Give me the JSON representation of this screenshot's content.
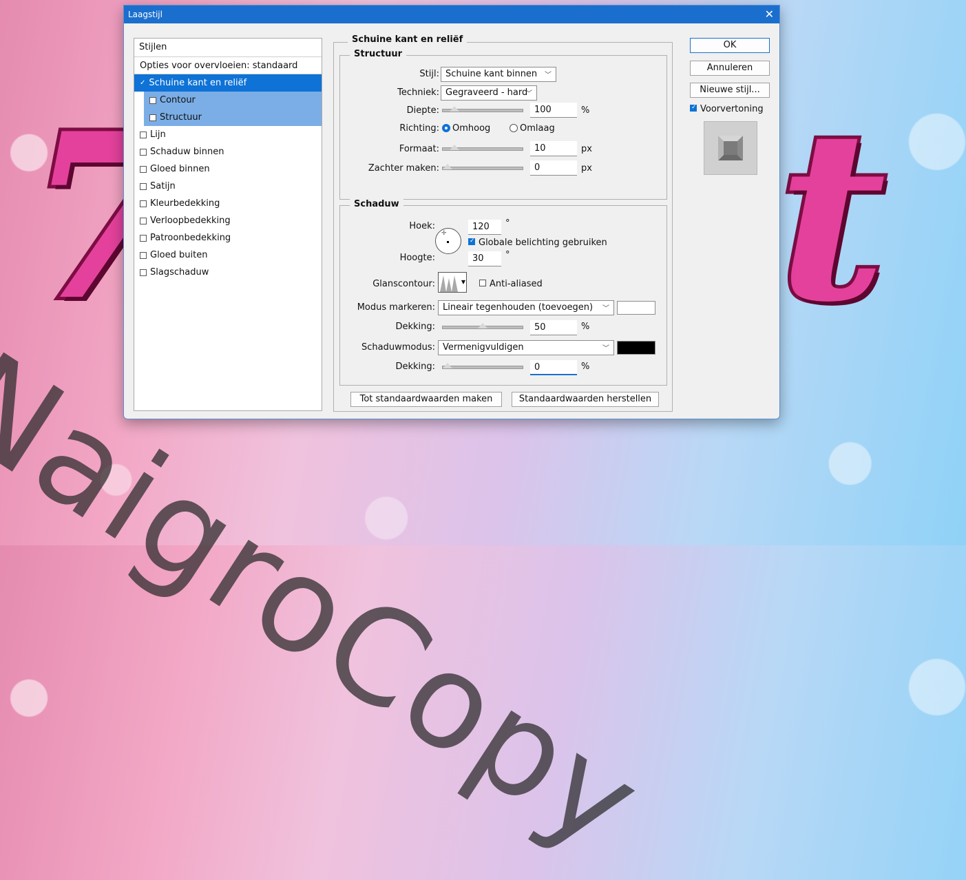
{
  "dialog": {
    "title": "Laagstijl",
    "close_glyph": "✕"
  },
  "styles_panel": {
    "header": "Stijlen",
    "blend_options": "Opties voor overvloeien: standaard",
    "items": [
      {
        "label": "Schuine kant en reliëf",
        "checked": true,
        "selected": true
      },
      {
        "label": "Contour",
        "checked": false,
        "sub": true
      },
      {
        "label": "Structuur",
        "checked": false,
        "sub": true
      },
      {
        "label": "Lijn",
        "checked": false
      },
      {
        "label": "Schaduw binnen",
        "checked": false
      },
      {
        "label": "Gloed binnen",
        "checked": false
      },
      {
        "label": "Satijn",
        "checked": false
      },
      {
        "label": "Kleurbedekking",
        "checked": false
      },
      {
        "label": "Verloopbedekking",
        "checked": false
      },
      {
        "label": "Patroonbedekking",
        "checked": false
      },
      {
        "label": "Gloed buiten",
        "checked": false
      },
      {
        "label": "Slagschaduw",
        "checked": false
      }
    ]
  },
  "bevel": {
    "section_title": "Schuine kant en reliëf",
    "structure": {
      "title": "Structuur",
      "style_label": "Stijl:",
      "style_value": "Schuine kant binnen",
      "technique_label": "Techniek:",
      "technique_value": "Gegraveerd - hard",
      "depth_label": "Diepte:",
      "depth_value": "100",
      "depth_unit": "%",
      "depth_slider": 0.1,
      "direction_label": "Richting:",
      "direction_up": "Omhoog",
      "direction_down": "Omlaag",
      "size_label": "Formaat:",
      "size_value": "10",
      "size_unit": "px",
      "size_slider": 0.1,
      "soften_label": "Zachter maken:",
      "soften_value": "0",
      "soften_unit": "px",
      "soften_slider": 0.0
    },
    "shading": {
      "title": "Schaduw",
      "angle_label": "Hoek:",
      "angle_value": "120",
      "angle_unit": "°",
      "global_light_label": "Globale belichting gebruiken",
      "altitude_label": "Hoogte:",
      "altitude_value": "30",
      "altitude_unit": "°",
      "gloss_label": "Glanscontour:",
      "anti_aliased_label": "Anti-aliased",
      "highlight_mode_label": "Modus markeren:",
      "highlight_mode_value": "Lineair tegenhouden (toevoegen)",
      "highlight_color": "#ffffff",
      "highlight_opacity_label": "Dekking:",
      "highlight_opacity_value": "50",
      "highlight_opacity_unit": "%",
      "highlight_opacity_slider": 0.5,
      "shadow_mode_label": "Schaduwmodus:",
      "shadow_mode_value": "Vermenigvuldigen",
      "shadow_color": "#000000",
      "shadow_opacity_label": "Dekking:",
      "shadow_opacity_value": "0",
      "shadow_opacity_unit": "%",
      "shadow_opacity_slider": 0.0
    },
    "make_default": "Tot standaardwaarden maken",
    "reset_default": "Standaardwaarden herstellen"
  },
  "actions": {
    "ok": "OK",
    "cancel": "Annuleren",
    "new_style": "Nieuwe stijl...",
    "preview_label": "Voorvertoning"
  },
  "watermark": "NaigroCopy",
  "colors": {
    "accent": "#0e72d6",
    "titlebar": "#1a6fce"
  }
}
